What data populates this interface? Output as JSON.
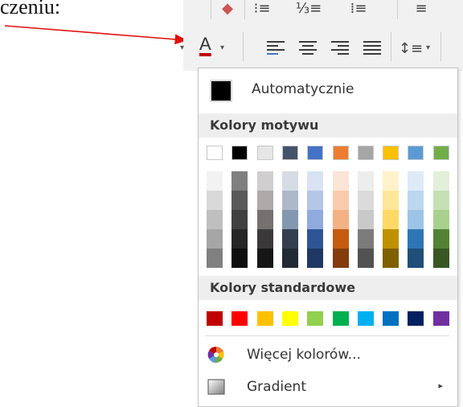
{
  "document": {
    "text": "czeniu:"
  },
  "ribbon": {
    "font_color_letter": "A",
    "caret": "▾",
    "line_spacing_icon": "line-spacing-icon"
  },
  "dropdown": {
    "automatic_label": "Automatycznie",
    "theme_colors_label": "Kolory motywu",
    "standard_colors_label": "Kolory standardowe",
    "more_colors_label": "Więcej kolorów...",
    "gradient_label": "Gradient",
    "submenu_arrow": "▸",
    "theme_colors": [
      [
        "#ffffff",
        "#f2f2f2",
        "#d9d9d9",
        "#bfbfbf",
        "#a6a6a6",
        "#808080"
      ],
      [
        "#000000",
        "#7f7f7f",
        "#595959",
        "#404040",
        "#262626",
        "#0d0d0d"
      ],
      [
        "#e7e6e6",
        "#d0cece",
        "#aeaaaa",
        "#757171",
        "#3a3838",
        "#161616"
      ],
      [
        "#44546a",
        "#d6dce4",
        "#adb9ca",
        "#8497b0",
        "#333f50",
        "#222a35"
      ],
      [
        "#4472c4",
        "#dae3f3",
        "#b4c7e7",
        "#8faadc",
        "#2f5597",
        "#1f3864"
      ],
      [
        "#ed7d31",
        "#fbe5d6",
        "#f8cbad",
        "#f4b183",
        "#c55a11",
        "#843c0c"
      ],
      [
        "#a5a5a5",
        "#ededed",
        "#dbdbdb",
        "#c9c9c9",
        "#7b7b7b",
        "#525252"
      ],
      [
        "#ffc000",
        "#fff2cc",
        "#ffe699",
        "#ffd966",
        "#bf9000",
        "#7f6000"
      ],
      [
        "#5b9bd5",
        "#deebf7",
        "#bdd7ee",
        "#9dc3e6",
        "#2e75b6",
        "#1f4e79"
      ],
      [
        "#70ad47",
        "#e2f0d9",
        "#c5e0b4",
        "#a9d18e",
        "#548235",
        "#385723"
      ]
    ],
    "standard_colors": [
      "#c00000",
      "#ff0000",
      "#ffc000",
      "#ffff00",
      "#92d050",
      "#00b050",
      "#00b0f0",
      "#0070c0",
      "#002060",
      "#7030a0"
    ]
  }
}
